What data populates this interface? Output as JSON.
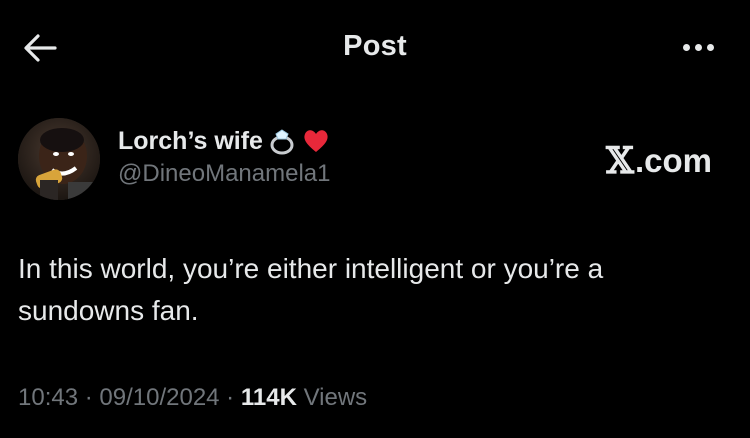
{
  "header": {
    "title": "Post",
    "back_icon": "arrow-left-icon",
    "more_icon": "more-horizontal-icon"
  },
  "tweet": {
    "author": {
      "display_name": "Lorch’s wife",
      "emoji_ring": "💍",
      "emoji_heart": "❤️",
      "handle": "@DineoManamela1",
      "avatar": "avatar-photo"
    },
    "watermark": {
      "logo": "𝕏",
      "suffix": ".com"
    },
    "text": "In this world, you’re either intelligent or you’re a sundowns fan.",
    "time": "10:43",
    "separator1": " · ",
    "date": "09/10/2024",
    "separator2": " · ",
    "views_count": "114K",
    "views_label": " Views"
  },
  "colors": {
    "background": "#000000",
    "primary_text": "#e7e9ea",
    "secondary_text": "#71767b"
  }
}
